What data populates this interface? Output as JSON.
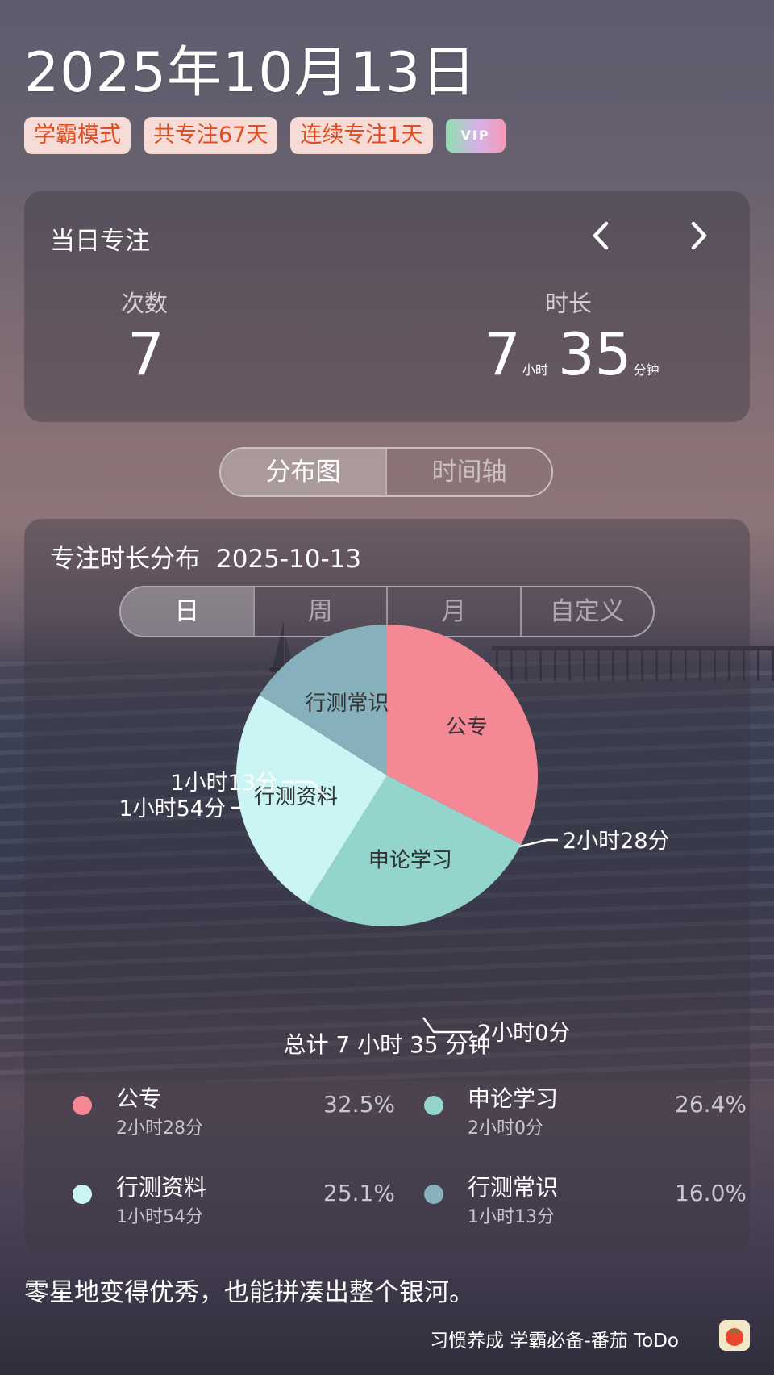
{
  "header": {
    "date": "2025年10月13日",
    "tags": [
      "学霸模式",
      "共专注67天",
      "连续专注1天"
    ],
    "vip_label": "VIP"
  },
  "daily_card": {
    "title": "当日专注",
    "prev_icon": "chevron-left-icon",
    "next_icon": "chevron-right-icon",
    "count_label": "次数",
    "count_value": "7",
    "duration_label": "时长",
    "duration_hours": "7",
    "hours_unit": "小时",
    "duration_minutes": "35",
    "minutes_unit": "分钟"
  },
  "view_toggle": {
    "options": [
      "分布图",
      "时间轴"
    ],
    "active_index": 0
  },
  "distribution": {
    "title": "专注时长分布",
    "date": "2025-10-13",
    "period_tabs": [
      "日",
      "周",
      "月",
      "自定义"
    ],
    "active_tab_index": 0,
    "total_text": "总计 7 小时 35 分钟"
  },
  "chart_data": {
    "type": "pie",
    "slices": [
      {
        "label": "公专",
        "minutes": 148,
        "duration": "2小时28分",
        "percent": "32.5%",
        "color": "#f58895"
      },
      {
        "label": "申论学习",
        "minutes": 120,
        "duration": "2小时0分",
        "percent": "26.4%",
        "color": "#93d4cc"
      },
      {
        "label": "行测资料",
        "minutes": 114,
        "duration": "1小时54分",
        "percent": "25.1%",
        "color": "#cbf5f5"
      },
      {
        "label": "行测常识",
        "minutes": 73,
        "duration": "1小时13分",
        "percent": "16.0%",
        "color": "#86b1bc"
      }
    ]
  },
  "quote": "零星地变得优秀，也能拼凑出整个银河。",
  "footer": {
    "text": "习惯养成 学霸必备-番茄 ToDo",
    "icon": "tomato-app-icon"
  }
}
